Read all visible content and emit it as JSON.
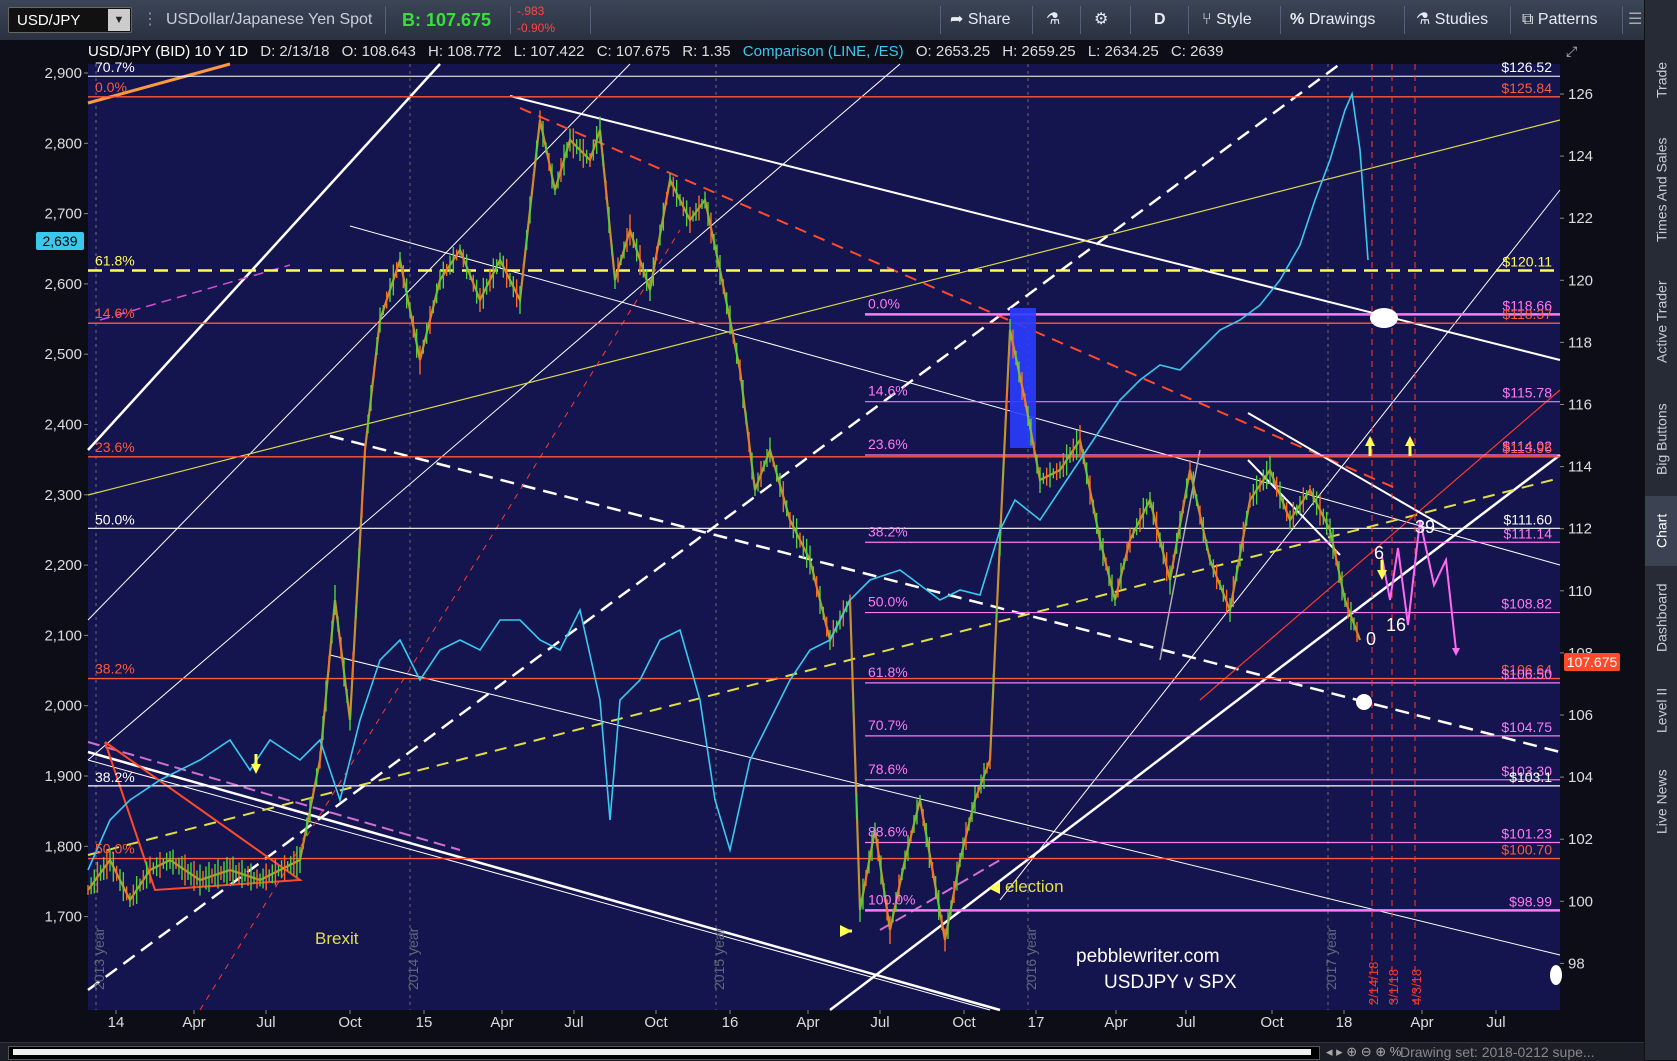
{
  "toolbar": {
    "symbol": "USD/JPY",
    "description": "USDollar/Japanese Yen Spot",
    "bid": "B: 107.675",
    "change": "-.983",
    "change_pct": "-0.90%",
    "share_label": "Share",
    "timeframe_label": "D",
    "style_label": "Style",
    "drawings_label": "Drawings",
    "studies_label": "Studies",
    "patterns_label": "Patterns"
  },
  "titlebar": {
    "name": "USD/JPY (BID) 10 Y 1D",
    "date": "D: 2/13/18",
    "open": "O: 108.643",
    "high": "H: 108.772",
    "low": "L: 107.422",
    "close": "C: 107.675",
    "range": "R: 1.35",
    "comparison": "Comparison (LINE, /ES)",
    "cmp_open": "O: 2653.25",
    "cmp_high": "H: 2659.25",
    "cmp_low": "L: 2634.25",
    "cmp_last": "C: 2639"
  },
  "left_axis": {
    "labels": [
      "2,900",
      "2,800",
      "2,700",
      "2,600",
      "2,500",
      "2,400",
      "2,300",
      "2,200",
      "2,100",
      "2,000",
      "1,900",
      "1,800",
      "1,700"
    ],
    "current_badge": "2,639"
  },
  "right_axis": {
    "labels": [
      "126",
      "124",
      "122",
      "120",
      "118",
      "116",
      "114",
      "112",
      "110",
      "108",
      "106",
      "104",
      "102",
      "100",
      "98"
    ],
    "current_badge": "107.675"
  },
  "x_axis": {
    "labels": [
      "14",
      "Apr",
      "Jul",
      "Oct",
      "15",
      "Apr",
      "Jul",
      "Oct",
      "16",
      "Apr",
      "Jul",
      "Oct",
      "17",
      "Apr",
      "Jul",
      "Oct",
      "18",
      "Apr",
      "Jul"
    ]
  },
  "year_markers": [
    "2013 year",
    "2014 year",
    "2015 year",
    "2016 year",
    "2017 year"
  ],
  "fib_left": {
    "orange": [
      "0.0%",
      "14.6%",
      "23.6%",
      "38.2%",
      "50.0%"
    ],
    "yellow": "61.8%",
    "white_top": "70.7%",
    "white": [
      "50.0%",
      "38.2%"
    ]
  },
  "fib_magenta": [
    "0.0%",
    "14.6%",
    "23.6%",
    "38.2%",
    "50.0%",
    "61.8%",
    "70.7%",
    "78.6%",
    "88.6%",
    "100.0%"
  ],
  "price_levels": [
    {
      "label": "$126.52",
      "color": "#ffffff"
    },
    {
      "label": "$125.84",
      "color": "#ff5a3c"
    },
    {
      "label": "$120.11",
      "color": "#ffff55"
    },
    {
      "label": "$118.66",
      "color": "#ff7af5"
    },
    {
      "label": "$118.37",
      "color": "#ff5a3c"
    },
    {
      "label": "$115.78",
      "color": "#ff7af5"
    },
    {
      "label": "$114.02",
      "color": "#ff7af5"
    },
    {
      "label": "$113.96",
      "color": "#ff5a3c"
    },
    {
      "label": "$111.60",
      "color": "#ffffff"
    },
    {
      "label": "$111.14",
      "color": "#ff7af5"
    },
    {
      "label": "$108.82",
      "color": "#ff7af5"
    },
    {
      "label": "$106.64",
      "color": "#ff5a3c"
    },
    {
      "label": "$106.50",
      "color": "#ff7af5"
    },
    {
      "label": "$104.75",
      "color": "#ff7af5"
    },
    {
      "label": "$103.30",
      "color": "#ff7af5"
    },
    {
      "label": "$103.1",
      "color": "#ffffff"
    },
    {
      "label": "$101.23",
      "color": "#ff7af5"
    },
    {
      "label": "$100.70",
      "color": "#ff5a3c"
    },
    {
      "label": "$98.99",
      "color": "#ff7af5"
    }
  ],
  "annotations": {
    "brexit": "Brexit",
    "election": "election",
    "site": "pebblewriter.com",
    "subtitle": "USDJPY v SPX",
    "wave_labels": [
      "39",
      "6",
      "16",
      "0"
    ],
    "dates": [
      "2/14/18",
      "3/1/18",
      "4/3/18"
    ]
  },
  "sidebar_tabs": [
    "Trade",
    "Times And Sales",
    "Active Trader",
    "Big Buttons",
    "Chart",
    "Dashboard",
    "Level II",
    "Live News"
  ],
  "drawing_set": "Drawing set: 2018-0212 supe...",
  "colors": {
    "chart_bg": "#14144e",
    "spx_line": "#3ac9ee",
    "fib_orange": "#ff5a3c",
    "fib_magenta": "#ff7af5",
    "fib_yellow": "#ffff55"
  }
}
